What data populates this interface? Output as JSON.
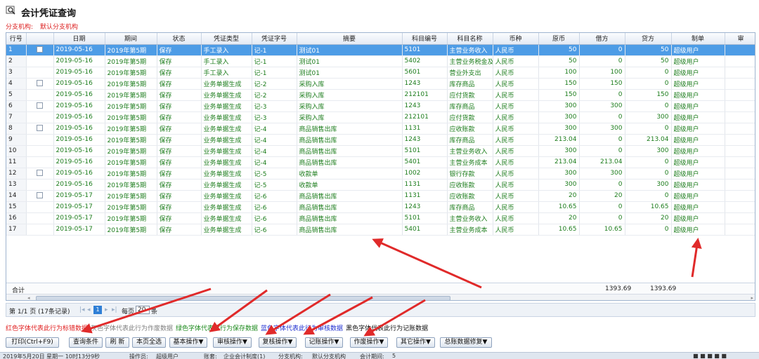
{
  "window": {
    "title": "会计凭证查询"
  },
  "branch": {
    "label": "分支机构:",
    "value": "默认分支机构"
  },
  "table": {
    "columns": [
      "行号",
      "",
      "日期",
      "期间",
      "状态",
      "凭证类型",
      "凭证字号",
      "摘要",
      "科目编号",
      "科目名称",
      "币种",
      "原币",
      "借方",
      "贷方",
      "制单",
      "审"
    ],
    "rows": [
      [
        "1",
        "cb",
        "2019-05-16",
        "2019年第5期",
        "保存",
        "手工录入",
        "记-1",
        "测试01",
        "5101",
        "主营业务收入",
        "人民币",
        "50",
        "0",
        "50",
        "超级用户"
      ],
      [
        "2",
        "",
        "2019-05-16",
        "2019年第5期",
        "保存",
        "手工录入",
        "记-1",
        "测试01",
        "5402",
        "主营业务税金及",
        "人民币",
        "50",
        "0",
        "50",
        "超级用户"
      ],
      [
        "3",
        "",
        "2019-05-16",
        "2019年第5期",
        "保存",
        "手工录入",
        "记-1",
        "测试01",
        "5601",
        "营业外支出",
        "人民币",
        "100",
        "100",
        "0",
        "超级用户"
      ],
      [
        "4",
        "cb",
        "2019-05-16",
        "2019年第5期",
        "保存",
        "业务单据生成",
        "记-2",
        "采购入库",
        "1243",
        "库存商品",
        "人民币",
        "150",
        "150",
        "0",
        "超级用户"
      ],
      [
        "5",
        "",
        "2019-05-16",
        "2019年第5期",
        "保存",
        "业务单据生成",
        "记-2",
        "采购入库",
        "212101",
        "应付货款",
        "人民币",
        "150",
        "0",
        "150",
        "超级用户"
      ],
      [
        "6",
        "cb",
        "2019-05-16",
        "2019年第5期",
        "保存",
        "业务单据生成",
        "记-3",
        "采购入库",
        "1243",
        "库存商品",
        "人民币",
        "300",
        "300",
        "0",
        "超级用户"
      ],
      [
        "7",
        "",
        "2019-05-16",
        "2019年第5期",
        "保存",
        "业务单据生成",
        "记-3",
        "采购入库",
        "212101",
        "应付货款",
        "人民币",
        "300",
        "0",
        "300",
        "超级用户"
      ],
      [
        "8",
        "cb",
        "2019-05-16",
        "2019年第5期",
        "保存",
        "业务单据生成",
        "记-4",
        "商品销售出库",
        "1131",
        "应收账款",
        "人民币",
        "300",
        "300",
        "0",
        "超级用户"
      ],
      [
        "9",
        "",
        "2019-05-16",
        "2019年第5期",
        "保存",
        "业务单据生成",
        "记-4",
        "商品销售出库",
        "1243",
        "库存商品",
        "人民币",
        "213.04",
        "0",
        "213.04",
        "超级用户"
      ],
      [
        "10",
        "",
        "2019-05-16",
        "2019年第5期",
        "保存",
        "业务单据生成",
        "记-4",
        "商品销售出库",
        "5101",
        "主营业务收入",
        "人民币",
        "300",
        "0",
        "300",
        "超级用户"
      ],
      [
        "11",
        "",
        "2019-05-16",
        "2019年第5期",
        "保存",
        "业务单据生成",
        "记-4",
        "商品销售出库",
        "5401",
        "主营业务成本",
        "人民币",
        "213.04",
        "213.04",
        "0",
        "超级用户"
      ],
      [
        "12",
        "cb",
        "2019-05-16",
        "2019年第5期",
        "保存",
        "业务单据生成",
        "记-5",
        "收款单",
        "1002",
        "银行存款",
        "人民币",
        "300",
        "300",
        "0",
        "超级用户"
      ],
      [
        "13",
        "",
        "2019-05-16",
        "2019年第5期",
        "保存",
        "业务单据生成",
        "记-5",
        "收款单",
        "1131",
        "应收账款",
        "人民币",
        "300",
        "0",
        "300",
        "超级用户"
      ],
      [
        "14",
        "cb",
        "2019-05-17",
        "2019年第5期",
        "保存",
        "业务单据生成",
        "记-6",
        "商品销售出库",
        "1131",
        "应收账款",
        "人民币",
        "20",
        "20",
        "0",
        "超级用户"
      ],
      [
        "15",
        "",
        "2019-05-17",
        "2019年第5期",
        "保存",
        "业务单据生成",
        "记-6",
        "商品销售出库",
        "1243",
        "库存商品",
        "人民币",
        "10.65",
        "0",
        "10.65",
        "超级用户"
      ],
      [
        "16",
        "",
        "2019-05-17",
        "2019年第5期",
        "保存",
        "业务单据生成",
        "记-6",
        "商品销售出库",
        "5101",
        "主营业务收入",
        "人民币",
        "20",
        "0",
        "20",
        "超级用户"
      ],
      [
        "17",
        "",
        "2019-05-17",
        "2019年第5期",
        "保存",
        "业务单据生成",
        "记-6",
        "商品销售出库",
        "5401",
        "主营业务成本",
        "人民币",
        "10.65",
        "10.65",
        "0",
        "超级用户"
      ]
    ],
    "selected_row": 1,
    "totals": {
      "label": "合计",
      "debit": "1393.69",
      "credit": "1393.69"
    }
  },
  "pager": {
    "page_info": "第 1/1 页 (17条记录)",
    "current_page": "1",
    "per_page_label": "每页",
    "per_page_value": "20",
    "per_page_unit": "条"
  },
  "legend": [
    {
      "text": "红色字体代表此行为标错数据",
      "color": "#e02020"
    },
    {
      "text": "灰色字体代表此行为作废数据",
      "color": "#808080"
    },
    {
      "text": "绿色字体代表此行为保存数据",
      "color": "#1d8a1d"
    },
    {
      "text": "蓝色字体代表此行为审核数据",
      "color": "#2030d0"
    },
    {
      "text": "黑色字体代表此行为记账数据",
      "color": "#111111"
    }
  ],
  "toolbar": {
    "print": "打印(Ctrl+F9)",
    "query": "查询条件",
    "refresh": "刷 新",
    "select_all": "本页全选",
    "basic": "基本操作▼",
    "audit": "审核操作▼",
    "review": "复核操作▼",
    "post": "记账操作▼",
    "void": "作废操作▼",
    "other": "其它操作▼",
    "ledger_fix": "总账数据修复▼"
  },
  "status": {
    "date": "2019年5月20日 星期一 10时13分9秒",
    "operator_label": "操作员:",
    "operator": "超级用户",
    "book_label": "账套:",
    "book": "企业会计制度(1)",
    "branch_label": "分支机构:",
    "branch": "默认分支机构",
    "period_label": "会计期间:",
    "period": "5"
  },
  "colors": {
    "selected": "#4d9ce6",
    "saved_text": "#1d7d1d",
    "arrow": "#e02a2a"
  }
}
